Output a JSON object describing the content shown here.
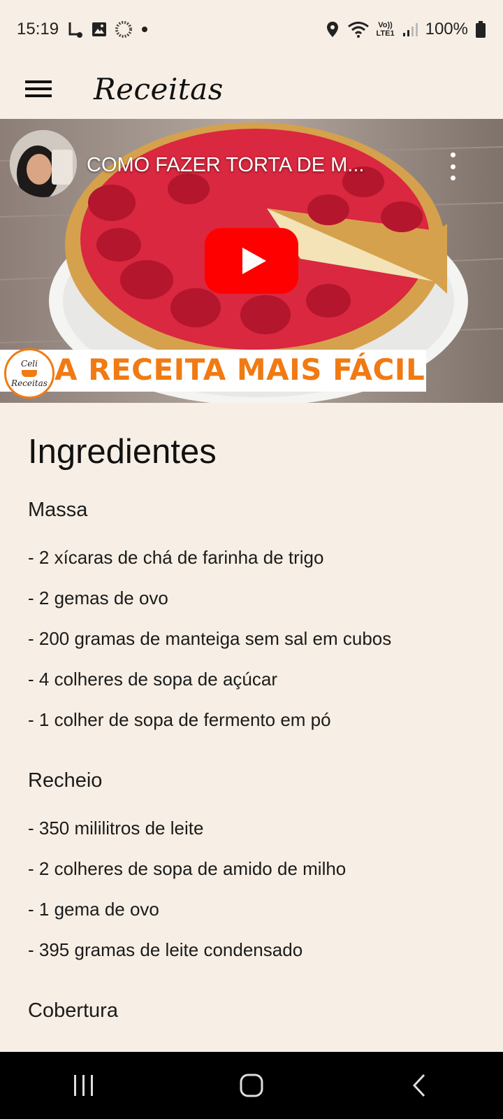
{
  "status_bar": {
    "time": "15:19",
    "battery": "100%",
    "net_label_top": "Vo))",
    "net_label_bottom": "LTE1",
    "icons": [
      "notification-icon",
      "gallery-icon",
      "loading-icon",
      "dot-icon",
      "location-icon",
      "wifi-icon",
      "signal-icon",
      "battery-icon"
    ]
  },
  "app_bar": {
    "title": "Receitas",
    "menu_icon": "hamburger-menu-icon"
  },
  "video": {
    "title": "COMO FAZER TORTA DE M...",
    "banner_text": "A RECEITA MAIS FÁCIL",
    "logo_line1": "Celi",
    "logo_line2": "Receitas",
    "colors": {
      "play_red": "#ff0000",
      "banner_orange": "#f07a13",
      "jelly": "#e0314b",
      "crust": "#d8a24a"
    }
  },
  "content": {
    "heading": "Ingredientes",
    "sections": [
      {
        "title": "Massa",
        "items": [
          "- 2 xícaras de chá de farinha de trigo",
          "- 2 gemas de ovo",
          "- 200 gramas de manteiga sem sal em cubos",
          "- 4 colheres de sopa de açúcar",
          "- 1 colher de sopa de fermento em pó"
        ]
      },
      {
        "title": "Recheio",
        "items": [
          "- 350 mililitros de leite",
          "- 2 colheres de sopa de amido de milho",
          "- 1 gema de ovo",
          "- 395 gramas de leite condensado"
        ]
      },
      {
        "title": "Cobertura",
        "items": []
      }
    ]
  },
  "nav_bar": {
    "buttons": [
      "recents-icon",
      "home-icon",
      "back-icon"
    ]
  },
  "colors": {
    "background": "#f7efe5",
    "nav_bar": "#000000",
    "text": "#1b1b1b"
  }
}
